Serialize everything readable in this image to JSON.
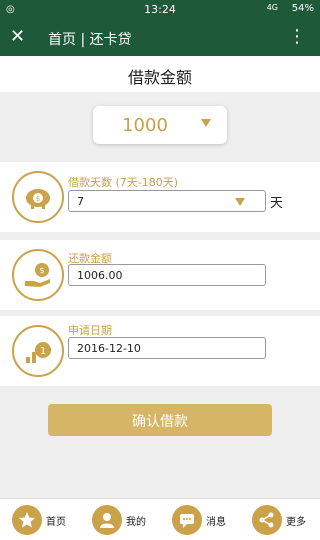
{
  "status": {
    "time": "13:24",
    "net": "4G",
    "battery": "54%"
  },
  "appbar": {
    "title": "首页 | 还卡贷"
  },
  "section_title": "借款金额",
  "amount": {
    "value": "1000"
  },
  "days": {
    "label": "借款天数 (7天-180天)",
    "value": "7",
    "unit": "天"
  },
  "repay": {
    "label": "还款金额",
    "value": "1006.00"
  },
  "date": {
    "label": "申请日期",
    "value": "2016-12-10"
  },
  "confirm_label": "确认借款",
  "tabs": [
    {
      "label": "首页",
      "icon": "star-icon"
    },
    {
      "label": "我的",
      "icon": "user-icon"
    },
    {
      "label": "消息",
      "icon": "message-icon"
    },
    {
      "label": "更多",
      "icon": "share-icon"
    }
  ],
  "colors": {
    "header_bg": "#1e5a3a",
    "accent": "#c9a24a",
    "button_bg": "#d6b566"
  }
}
